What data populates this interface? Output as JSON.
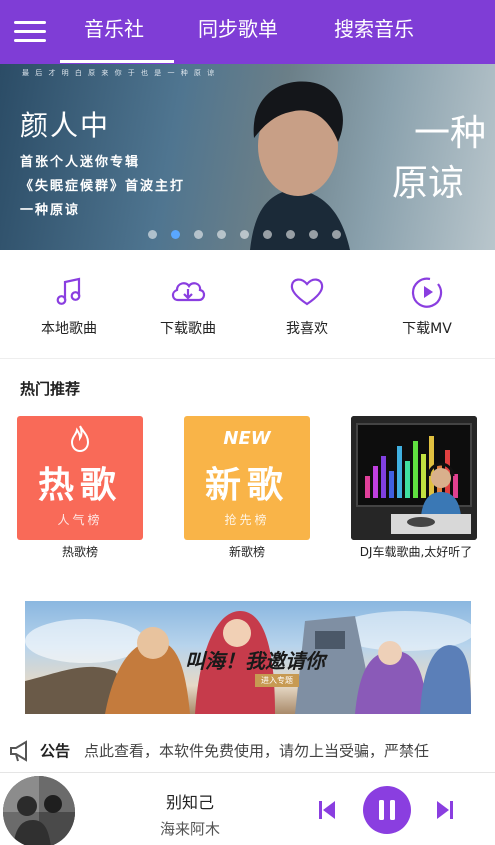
{
  "tabs": [
    {
      "label": "音乐社",
      "active": true
    },
    {
      "label": "同步歌单"
    },
    {
      "label": "搜索音乐"
    }
  ],
  "banner": {
    "top_line": "最 后 才 明 白 原 来 你 于 也 是 一 种 原 谅",
    "singer": "颜人中",
    "lines": [
      "首张个人迷你专辑",
      "《失眠症候群》首波主打",
      "一种原谅"
    ],
    "brand": [
      "一种",
      "原谅"
    ],
    "indicator_count": 9,
    "active_indicator": 1
  },
  "quick_actions": [
    {
      "label": "本地歌曲",
      "icon": "music-note-icon"
    },
    {
      "label": "下载歌曲",
      "icon": "cloud-download-icon"
    },
    {
      "label": "我喜欢",
      "icon": "heart-icon"
    },
    {
      "label": "下载MV",
      "icon": "play-circle-icon"
    }
  ],
  "hot": {
    "title": "热门推荐",
    "cards": [
      {
        "title": "热歌",
        "subtitle": "人气榜",
        "caption": "热歌榜",
        "color": "#f96a58"
      },
      {
        "title": "新歌",
        "subtitle": "抢先榜",
        "tag": "NEW",
        "caption": "新歌榜",
        "color": "#f9b448"
      },
      {
        "caption": "DJ车载歌曲,太好听了",
        "color": "#2a2a2a"
      }
    ]
  },
  "game_banner": {
    "slogan": "叫海！我邀请你",
    "button": "进入专题"
  },
  "notice": {
    "label": "公告",
    "text": "点此查看，本软件免费使用，请勿上当受骗，严禁任"
  },
  "player": {
    "song": "别知己",
    "artist": "海来阿木"
  },
  "colors": {
    "primary": "#7f3dd6",
    "accent": "#8a3ee0"
  }
}
